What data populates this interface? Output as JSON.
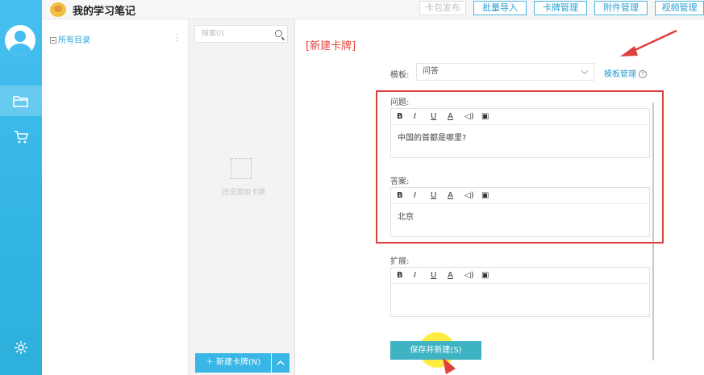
{
  "app": {
    "title": "我的学习笔记"
  },
  "header": {
    "buttons": [
      {
        "label": "卡包发布",
        "enabled": false
      },
      {
        "label": "批量导入",
        "enabled": true
      },
      {
        "label": "卡牌管理",
        "enabled": true
      },
      {
        "label": "附件管理",
        "enabled": true
      },
      {
        "label": "视频管理",
        "enabled": true
      }
    ]
  },
  "sidebar": {
    "items": [
      {
        "icon": "folder-icon",
        "active": true
      },
      {
        "icon": "cart-icon",
        "active": false
      },
      {
        "icon": "gear-icon",
        "active": false
      }
    ]
  },
  "tree": {
    "root_label": "所有目录",
    "more": "⋮"
  },
  "cards": {
    "search_placeholder": "搜索(/)",
    "empty_text": "还没添加卡牌",
    "new_card_label": "＋ 新建卡牌(N)"
  },
  "editor": {
    "title": "[新建卡牌]",
    "template_label": "模板:",
    "template_value": "问答",
    "template_manage": "模板管理",
    "toolbar": [
      "B",
      "I",
      "U",
      "A",
      "◁)",
      "▣"
    ],
    "fields": [
      {
        "label": "问题:",
        "value": "中国的首都是哪里?"
      },
      {
        "label": "答案:",
        "value": "北京"
      },
      {
        "label": "扩展:",
        "value": ""
      }
    ],
    "save_label": "保存并新建(S)"
  },
  "colors": {
    "accent": "#38b6e6",
    "annotation": "#e0403c",
    "highlight": "#ffe600"
  }
}
